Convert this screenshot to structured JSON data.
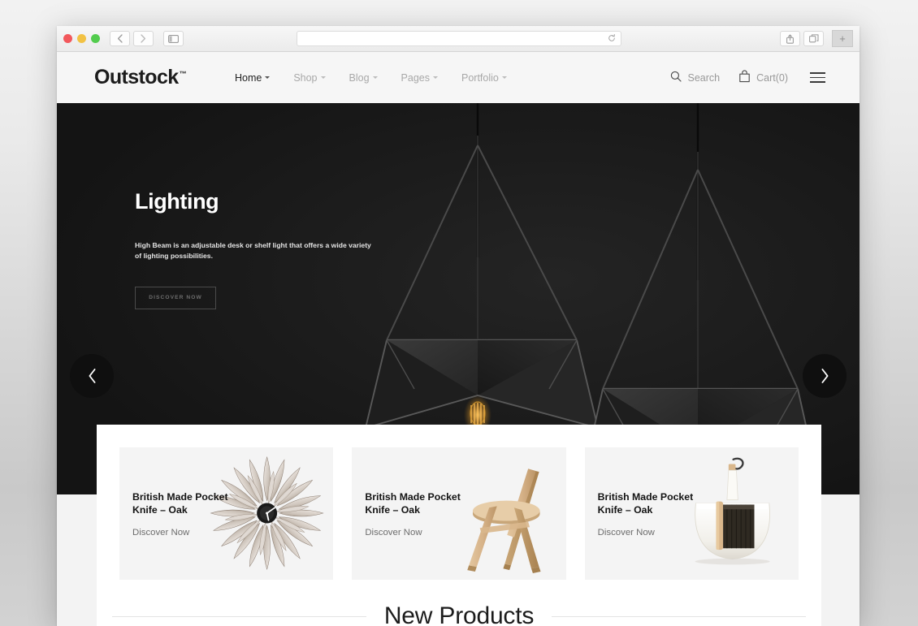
{
  "browser": {
    "traffic_lights": [
      "close",
      "minimize",
      "zoom"
    ],
    "back_label": "Back",
    "forward_label": "Forward",
    "sidebar_label": "Show Sidebar",
    "url_value": "",
    "url_placeholder": "",
    "reload_label": "Reload",
    "share_label": "Share",
    "tabs_label": "Show Tab Overview",
    "new_tab_label": "+"
  },
  "header": {
    "brand": "Outstock",
    "brand_tm": "™",
    "nav": [
      {
        "label": "Home",
        "active": true
      },
      {
        "label": "Shop",
        "active": false
      },
      {
        "label": "Blog",
        "active": false
      },
      {
        "label": "Pages",
        "active": false
      },
      {
        "label": "Portfolio",
        "active": false
      }
    ],
    "search_label": "Search",
    "cart_label": "Cart(0)",
    "menu_label": "Menu"
  },
  "hero": {
    "title": "Lighting",
    "description": "High Beam is an adjustable desk or shelf light that offers a wide variety of lighting possibilities.",
    "cta_label": "DISCOVER NOW",
    "prev_label": "Previous slide",
    "next_label": "Next slide",
    "background_color": "#1c1c1c"
  },
  "promo_cards": [
    {
      "title": "British Made Pocket Knife – Oak",
      "link_label": "Discover Now",
      "art": "sunflower-clock"
    },
    {
      "title": "British Made Pocket Knife – Oak",
      "link_label": "Discover Now",
      "art": "wooden-chair"
    },
    {
      "title": "British Made Pocket Knife – Oak",
      "link_label": "Discover Now",
      "art": "dustpan-brush"
    }
  ],
  "sections": {
    "new_products_title": "New Products"
  },
  "colors": {
    "page_background": "#f3f3f3",
    "panel_background": "#ffffff",
    "card_background": "#f4f4f4",
    "hero_background": "#1c1c1c",
    "text_primary": "#141414",
    "text_muted": "#a8a8a8"
  }
}
